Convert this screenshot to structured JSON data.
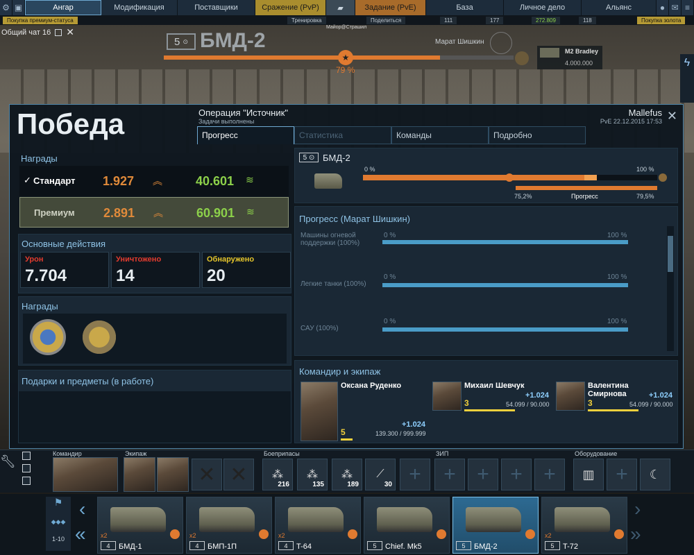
{
  "nav": {
    "tabs": [
      {
        "label": "Ангар"
      },
      {
        "label": "Модификация"
      },
      {
        "label": "Поставщики"
      },
      {
        "label": "Сражение (PvP)"
      },
      {
        "label": "Задание (PvE)"
      },
      {
        "label": "База"
      },
      {
        "label": "Личное дело"
      },
      {
        "label": "Альянс"
      }
    ],
    "sub": {
      "premium": "Покупка премиум-статуса",
      "training": "Тренировка",
      "share": "Поделиться",
      "res1": "111",
      "res2": "177",
      "res3": "272.809",
      "res4": "118",
      "gold": "Покупка золота",
      "center_label": "Майор@Страшил"
    }
  },
  "chat": {
    "label": "Общий чат 16"
  },
  "vehicle": {
    "tier": "5",
    "name": "БМД-2",
    "progress_pct": 79,
    "progress_label": "79 %",
    "commander": "Марат Шишкин",
    "next_name": "M2 Bradley",
    "next_cost": "4.000.000"
  },
  "modal": {
    "title": "Победа",
    "operation": "Операция \"Источник\"",
    "operation_sub": "Задачи выполнены",
    "user": "Mallefus",
    "date": "PvE 22.12.2015 17:53",
    "tabs": [
      "Прогресс",
      "Статистика",
      "Команды",
      "Подробно"
    ],
    "rewards": {
      "header": "Награды",
      "std_label": "Стандарт",
      "std_xp": "1.927",
      "std_credits": "40.601",
      "prem_label": "Премиум",
      "prem_xp": "2.891",
      "prem_credits": "60.901"
    },
    "actions": {
      "header": "Основные действия",
      "items": [
        {
          "label": "Урон",
          "value": "7.704",
          "color": "#e23b2e"
        },
        {
          "label": "Уничтожено",
          "value": "14",
          "color": "#e23b2e"
        },
        {
          "label": "Обнаружено",
          "value": "20",
          "color": "#e5c52b"
        }
      ]
    },
    "medals_header": "Награды",
    "gifts_header": "Подарки и предметы (в работе)",
    "veh_progress": {
      "tier": "5",
      "name": "БМД-2",
      "start": "0 %",
      "end": "100 %",
      "before_pct": "75,2%",
      "progress_label": "Прогресс",
      "after_pct": "79,5%",
      "before_value": 75.2,
      "after_value": 79.5
    },
    "commander_progress": {
      "header": "Прогресс (Марат Шишкин)",
      "rows": [
        {
          "label": "Машины огневой поддержки (100%)",
          "start": "0 %",
          "end": "100 %"
        },
        {
          "label": "Легкие танки (100%)",
          "start": "0 %",
          "end": "100 %"
        },
        {
          "label": "САУ (100%)",
          "start": "0 %",
          "end": "100 %"
        }
      ]
    },
    "crew": {
      "header": "Командир и экипаж",
      "members": [
        {
          "name": "Оксана Руденко",
          "xp": "+1.024",
          "level": "5",
          "progress": "139.300 / 999.999",
          "progress_value": 139300,
          "progress_max": 999999
        },
        {
          "name": "Михаил Шевчук",
          "xp": "+1.024",
          "level": "3",
          "progress": "54.099 / 90.000",
          "progress_value": 54099,
          "progress_max": 90000
        },
        {
          "name": "Валентина Смирнова",
          "xp": "+1.024",
          "level": "3",
          "progress": "54.099 / 90.000",
          "progress_value": 54099,
          "progress_max": 90000
        }
      ]
    }
  },
  "hud": {
    "commander": "Командир",
    "crew": "Экипаж",
    "ammo": "Боеприпасы",
    "zip": "ЗИП",
    "equipment": "Оборудование",
    "ammo_counts": [
      "216",
      "135",
      "189",
      "30"
    ],
    "tier_range": "1-10"
  },
  "carousel": {
    "vehicles": [
      {
        "tier": "4",
        "name": "БМД-1",
        "mult": "x2"
      },
      {
        "tier": "4",
        "name": "БМП-1П",
        "mult": "x2"
      },
      {
        "tier": "4",
        "name": "T-64",
        "mult": "x2"
      },
      {
        "tier": "5",
        "name": "Chief. Mk5",
        "mult": ""
      },
      {
        "tier": "5",
        "name": "БМД-2",
        "mult": ""
      },
      {
        "tier": "5",
        "name": "T-72",
        "mult": "x2"
      }
    ]
  }
}
